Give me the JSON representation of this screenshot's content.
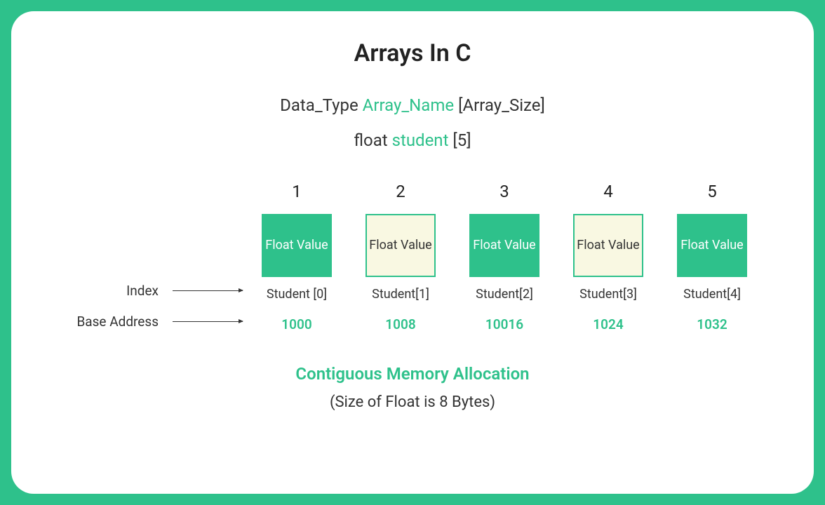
{
  "title": "Arrays In C",
  "syntax": {
    "data_type": "Data_Type",
    "array_name": "Array_Name",
    "array_size": "[Array_Size]"
  },
  "example": {
    "data_type": "float",
    "array_name": "student",
    "array_size": "[5]"
  },
  "labels": {
    "index": "Index",
    "base_address": "Base Address"
  },
  "cells": [
    {
      "num": "1",
      "value": "Float Value",
      "variant": "green",
      "index": "Student [0]",
      "address": "1000"
    },
    {
      "num": "2",
      "value": "Float Value",
      "variant": "cream",
      "index": "Student[1]",
      "address": "1008"
    },
    {
      "num": "3",
      "value": "Float Value",
      "variant": "green",
      "index": "Student[2]",
      "address": "10016"
    },
    {
      "num": "4",
      "value": "Float Value",
      "variant": "cream",
      "index": "Student[3]",
      "address": "1024"
    },
    {
      "num": "5",
      "value": "Float Value",
      "variant": "green",
      "index": "Student[4]",
      "address": "1032"
    }
  ],
  "footer": {
    "title": "Contiguous Memory Allocation",
    "sub": "(Size of Float is 8 Bytes)"
  }
}
